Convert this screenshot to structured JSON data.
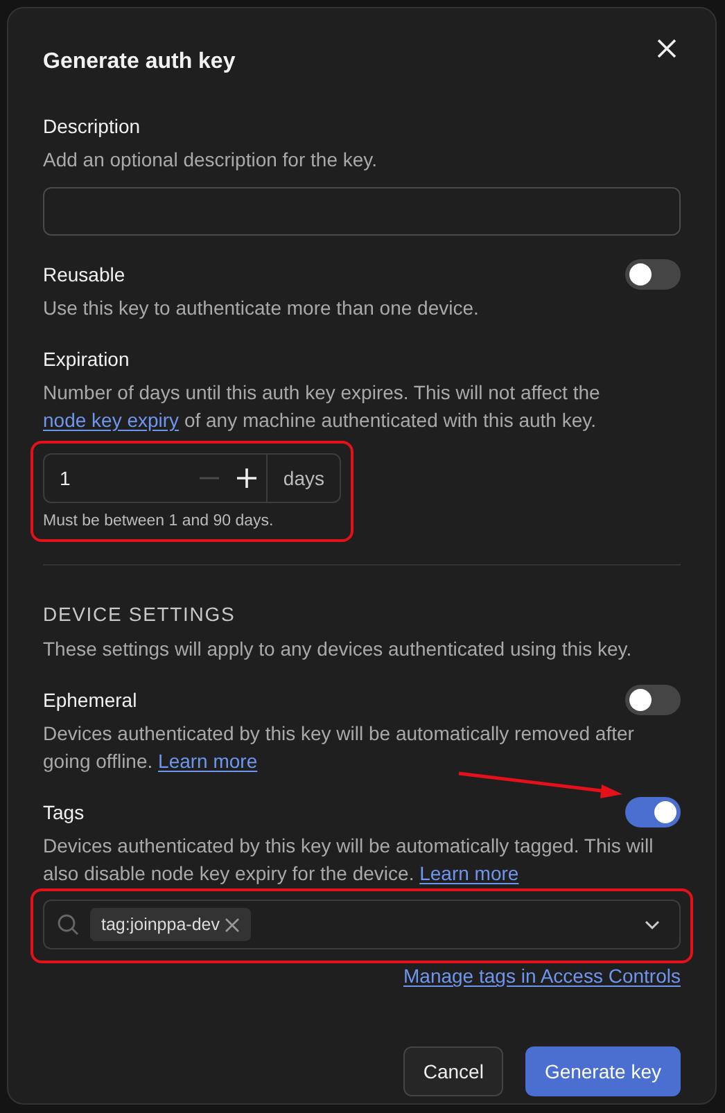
{
  "dialog": {
    "title": "Generate auth key"
  },
  "description": {
    "label": "Description",
    "help": [
      {
        "text": "Add an optional description for the key."
      }
    ]
  },
  "reusable": {
    "label": "Reusable",
    "help": [
      {
        "text": "Use this key to authenticate more than one device."
      }
    ],
    "on": false
  },
  "expiration": {
    "label": "Expiration",
    "help": [
      {
        "text": "Number of days until this auth key expires. This will not affect the "
      },
      {
        "text": "node key expiry",
        "link": true
      },
      {
        "text": " of any machine authenticated with this auth key."
      }
    ],
    "value": "1",
    "decrement_disabled": true,
    "unit": "days",
    "hint": "Must be between 1 and 90 days.",
    "highlighted": true
  },
  "device_settings": {
    "heading": "DEVICE SETTINGS",
    "help": "These settings will apply to any devices authenticated using this key."
  },
  "settings": [
    {
      "label": "Ephemeral",
      "help": [
        {
          "text": "Devices authenticated by this key will be automatically removed after going offline. "
        },
        {
          "text": "Learn more",
          "link": true
        }
      ],
      "on": false,
      "arrow": false
    },
    {
      "label": "Tags",
      "help": [
        {
          "text": "Devices authenticated by this key will be automatically tagged. This will also disable node key expiry for the device. "
        },
        {
          "text": "Learn more",
          "link": true
        }
      ],
      "on": true,
      "arrow": true
    }
  ],
  "tag_select": {
    "tags": [
      {
        "label": "tag:joinppa-dev"
      }
    ],
    "highlighted": true
  },
  "manage_link": "Manage tags in Access Controls",
  "buttons": [
    {
      "label": "Cancel",
      "kind": "secondary"
    },
    {
      "label": "Generate key",
      "kind": "primary"
    }
  ]
}
